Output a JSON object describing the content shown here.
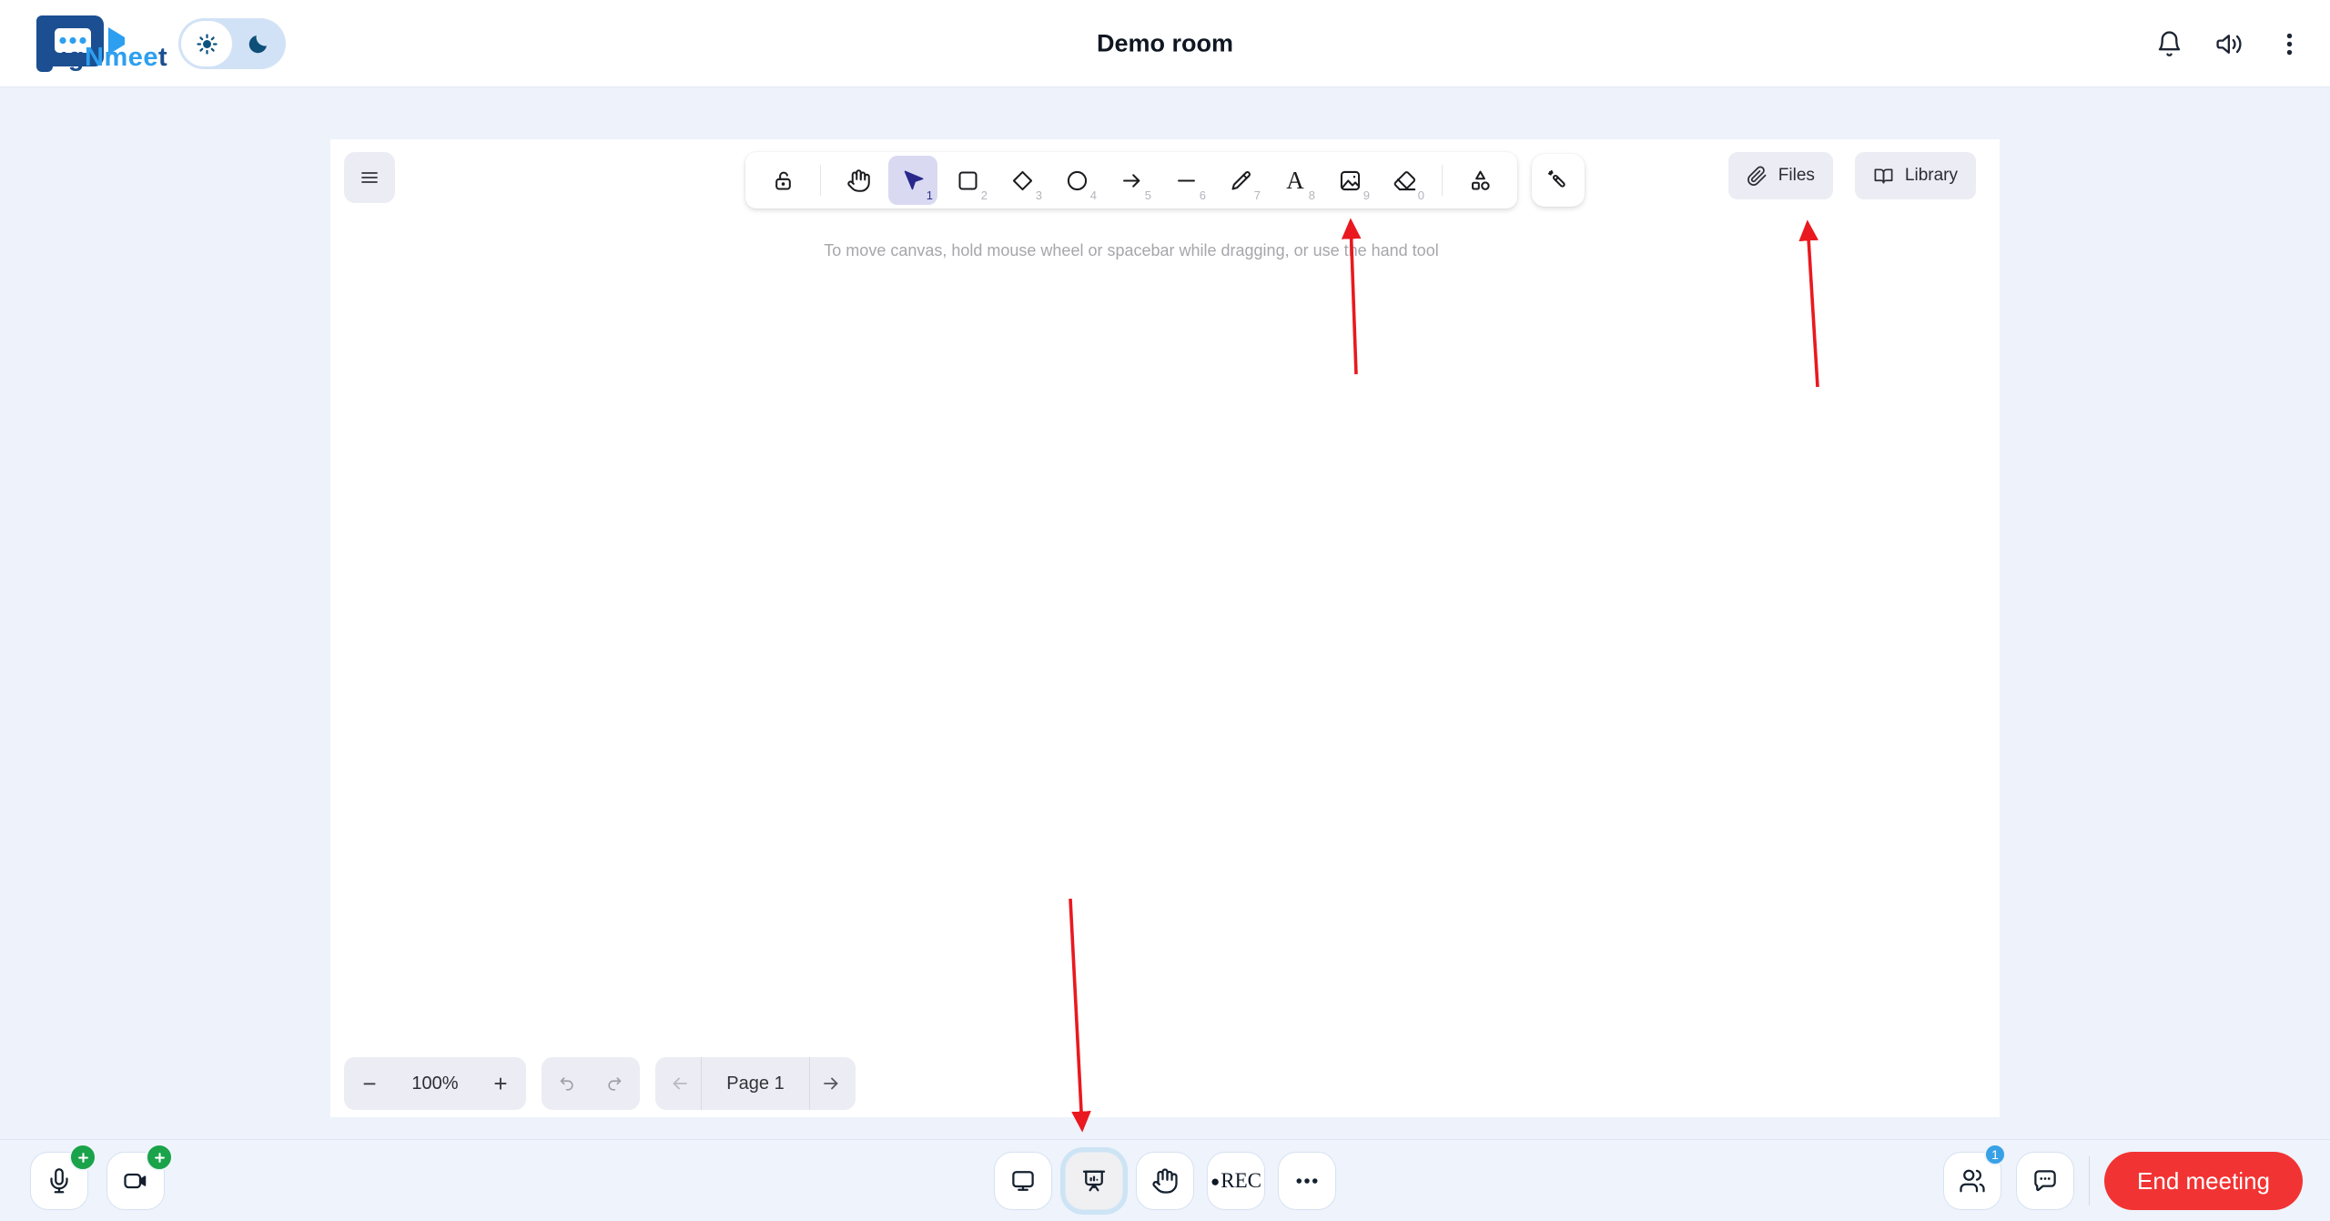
{
  "header": {
    "brand_seg1": "lug",
    "brand_seg2": "Nmee",
    "brand_seg3": "t",
    "room_title": "Demo room"
  },
  "whiteboard": {
    "hint": "To move canvas, hold mouse wheel or spacebar while dragging, or use the hand tool",
    "files_label": "Files",
    "library_label": "Library",
    "text_tool_glyph": "A",
    "tool_numbers": {
      "selection": "1",
      "rectangle": "2",
      "diamond": "3",
      "ellipse": "4",
      "arrow": "5",
      "line": "6",
      "draw": "7",
      "text": "8",
      "image": "9",
      "eraser": "0"
    },
    "zoom_out": "−",
    "zoom_value": "100%",
    "zoom_in": "+",
    "page_label": "Page 1"
  },
  "footer": {
    "rec_dot": "●",
    "rec_label": "REC",
    "participants_badge": "1",
    "end_meeting_label": "End meeting"
  },
  "colors": {
    "annotation_red": "#e9191f",
    "end_meeting_red": "#f23333",
    "badge_green": "#1aa34a",
    "badge_blue": "#38a1e6",
    "active_tool_bg": "#d9d9f2"
  }
}
